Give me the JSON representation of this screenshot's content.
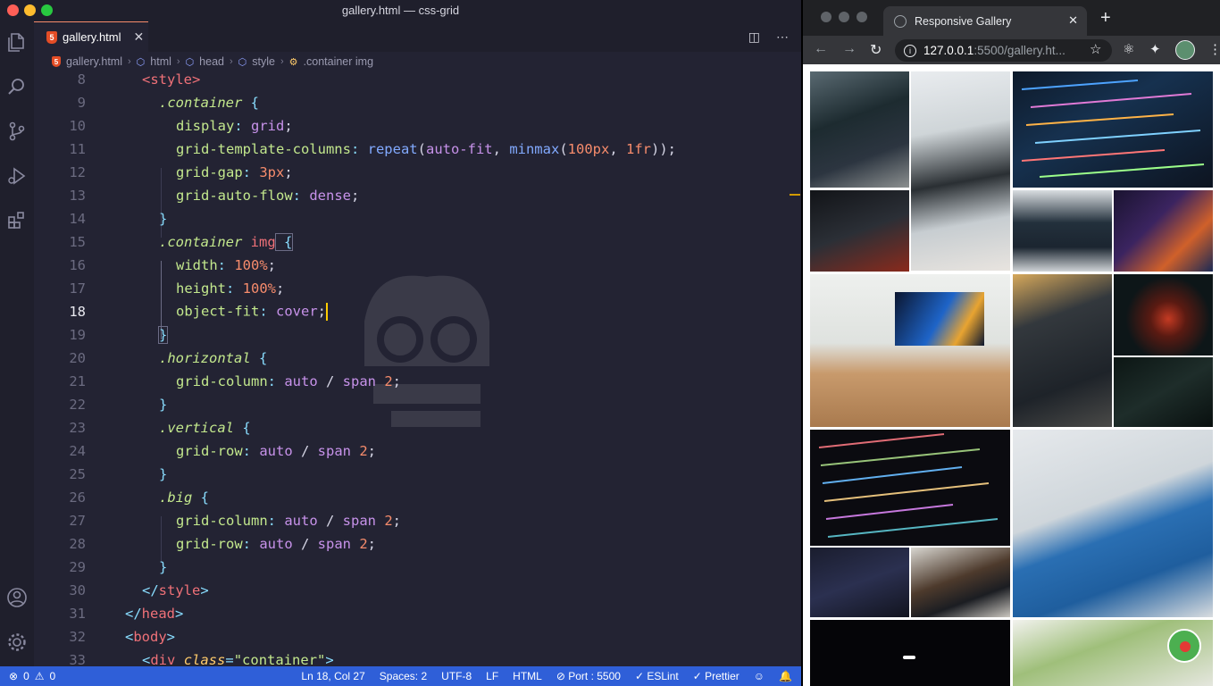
{
  "window": {
    "title": "gallery.html — css-grid"
  },
  "editor": {
    "tab_label": "gallery.html",
    "breadcrumb": [
      "gallery.html",
      "html",
      "head",
      "style",
      ".container img"
    ],
    "lines": [
      {
        "n": "8"
      },
      {
        "n": "9"
      },
      {
        "n": "10"
      },
      {
        "n": "11"
      },
      {
        "n": "12"
      },
      {
        "n": "13"
      },
      {
        "n": "14"
      },
      {
        "n": "15"
      },
      {
        "n": "16"
      },
      {
        "n": "17"
      },
      {
        "n": "18"
      },
      {
        "n": "19"
      },
      {
        "n": "20"
      },
      {
        "n": "21"
      },
      {
        "n": "22"
      },
      {
        "n": "23"
      },
      {
        "n": "24"
      },
      {
        "n": "25"
      },
      {
        "n": "26"
      },
      {
        "n": "27"
      },
      {
        "n": "28"
      },
      {
        "n": "29"
      },
      {
        "n": "30"
      },
      {
        "n": "31"
      },
      {
        "n": "32"
      },
      {
        "n": "33"
      }
    ],
    "code": {
      "l8": "<style>",
      "l9_sel": ".container",
      "l10_prop": "display",
      "l10_val": "grid",
      "l11_prop": "grid-template-columns",
      "l11_fn": "repeat",
      "l11_a": "auto-fit",
      "l11_fn2": "minmax",
      "l11_n1": "100px",
      "l11_n2": "1fr",
      "l12_prop": "grid-gap",
      "l12_val": "3px",
      "l13_prop": "grid-auto-flow",
      "l13_val": "dense",
      "l15_sel": ".container",
      "l15_tag": "img",
      "l16_prop": "width",
      "l16_val": "100%",
      "l17_prop": "height",
      "l17_val": "100%",
      "l18_prop": "object-fit",
      "l18_val": "cover",
      "l20_sel": ".horizontal",
      "l21_prop": "grid-column",
      "l21_val": "auto",
      "l21_span": "span",
      "l21_n": "2",
      "l23_sel": ".vertical",
      "l24_prop": "grid-row",
      "l24_val": "auto",
      "l24_span": "span",
      "l24_n": "2",
      "l26_sel": ".big",
      "l27_prop": "grid-column",
      "l27_val": "auto",
      "l27_span": "span",
      "l27_n": "2",
      "l28_prop": "grid-row",
      "l28_val": "auto",
      "l28_span": "span",
      "l28_n": "2",
      "l30": "style",
      "l31": "head",
      "l32": "body",
      "l33_tag": "div",
      "l33_attr": "class",
      "l33_str": "\"container\""
    }
  },
  "statusbar": {
    "errors": "0",
    "warnings": "0",
    "position": "Ln 18, Col 27",
    "spaces": "Spaces: 2",
    "encoding": "UTF-8",
    "eol": "LF",
    "language": "HTML",
    "port": "Port : 5500",
    "eslint": "ESLint",
    "prettier": "Prettier"
  },
  "browser": {
    "tab_title": "Responsive Gallery",
    "url_host": "127.0.0.1",
    "url_path": ":5500/gallery.ht..."
  },
  "colors": {
    "statusbar": "#2f5fd8",
    "editor_bg": "#232333",
    "accent": "#f78c6c"
  }
}
